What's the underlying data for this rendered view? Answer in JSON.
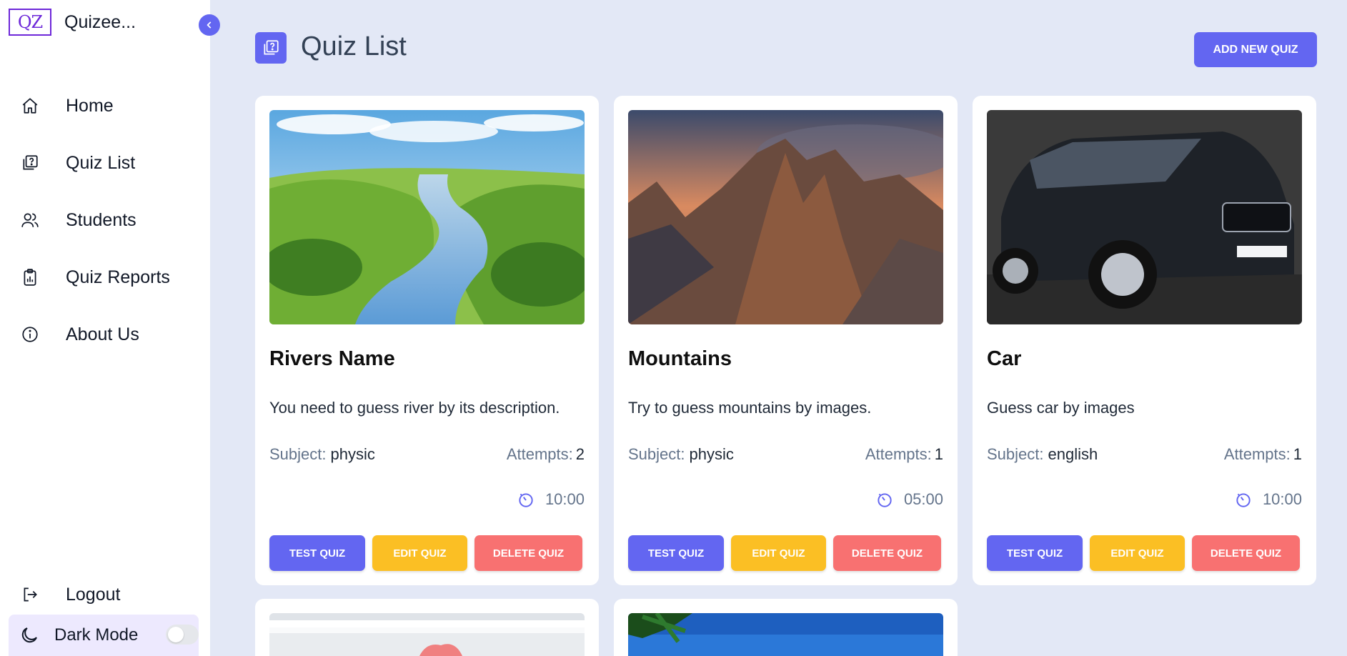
{
  "app": {
    "logo_text": "QZ",
    "name": "Quizee..."
  },
  "sidebar": {
    "items": [
      {
        "label": "Home",
        "icon": "home-icon"
      },
      {
        "label": "Quiz List",
        "icon": "quiz-list-icon"
      },
      {
        "label": "Students",
        "icon": "users-icon"
      },
      {
        "label": "Quiz Reports",
        "icon": "clipboard-icon"
      },
      {
        "label": "About Us",
        "icon": "info-icon"
      }
    ],
    "logout_label": "Logout",
    "dark_mode_label": "Dark Mode",
    "dark_mode_on": false
  },
  "header": {
    "title": "Quiz List",
    "add_button": "ADD NEW QUIZ"
  },
  "labels": {
    "subject": "Subject:",
    "attempts": "Attempts:"
  },
  "buttons": {
    "test": "TEST QUIZ",
    "edit": "EDIT QUIZ",
    "delete": "DELETE QUIZ"
  },
  "quizzes": [
    {
      "title": "Rivers Name",
      "description": "You need to guess river by its description.",
      "subject": "physic",
      "attempts": "2",
      "time": "10:00",
      "image": "river landscape"
    },
    {
      "title": "Mountains",
      "description": "Try to guess mountains by images.",
      "subject": "physic",
      "attempts": "1",
      "time": "05:00",
      "image": "mountain peaks at sunset"
    },
    {
      "title": "Car",
      "description": "Guess car by images",
      "subject": "english",
      "attempts": "1",
      "time": "10:00",
      "image": "black SUV car"
    }
  ],
  "colors": {
    "accent": "#6366f1",
    "edit": "#fbbf24",
    "delete": "#f87171",
    "background": "#e3e8f6"
  }
}
